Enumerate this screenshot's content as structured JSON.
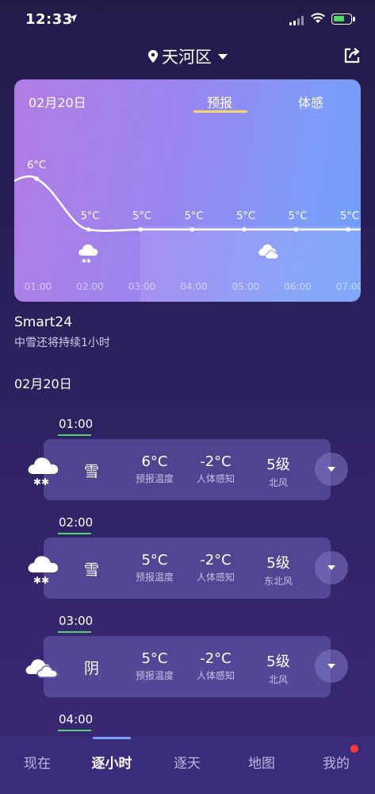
{
  "status": {
    "time": "12:33"
  },
  "header": {
    "location": "天河区"
  },
  "card": {
    "date": "02月20日",
    "tabs": [
      "预报",
      "体感"
    ],
    "active_tab": "预报"
  },
  "chart_data": {
    "type": "line",
    "x": [
      "01:00",
      "02:00",
      "03:00",
      "04:00",
      "05:00",
      "06:00",
      "07:00"
    ],
    "series": [
      {
        "values": [
          6,
          5,
          5,
          5,
          5,
          5,
          5
        ]
      }
    ],
    "data_labels": [
      "6°C",
      "5°C",
      "5°C",
      "5°C",
      "5°C",
      "5°C",
      "5°C"
    ],
    "weather_icons": [
      "snow-cloud-icon",
      "cloudy-icon"
    ]
  },
  "summary": {
    "title": "Smart24",
    "subtitle": "中雪还将持续1小时"
  },
  "day_label": "02月20日",
  "hours": [
    {
      "time": "01:00",
      "condition": "雪",
      "icon": "snow-cloud-icon",
      "temp": "6°C",
      "temp_label": "预报温度",
      "feel": "-2°C",
      "feel_label": "人体感知",
      "wind": "5级",
      "wind_dir": "北风"
    },
    {
      "time": "02:00",
      "condition": "雪",
      "icon": "snow-cloud-icon",
      "temp": "5°C",
      "temp_label": "预报温度",
      "feel": "-2°C",
      "feel_label": "人体感知",
      "wind": "5级",
      "wind_dir": "东北风"
    },
    {
      "time": "03:00",
      "condition": "阴",
      "icon": "cloudy-icon",
      "temp": "5°C",
      "temp_label": "预报温度",
      "feel": "-2°C",
      "feel_label": "人体感知",
      "wind": "5级",
      "wind_dir": "北风"
    },
    {
      "time": "04:00"
    }
  ],
  "nav": {
    "items": [
      "现在",
      "逐小时",
      "逐天",
      "地图",
      "我的"
    ],
    "active": "逐小时"
  }
}
